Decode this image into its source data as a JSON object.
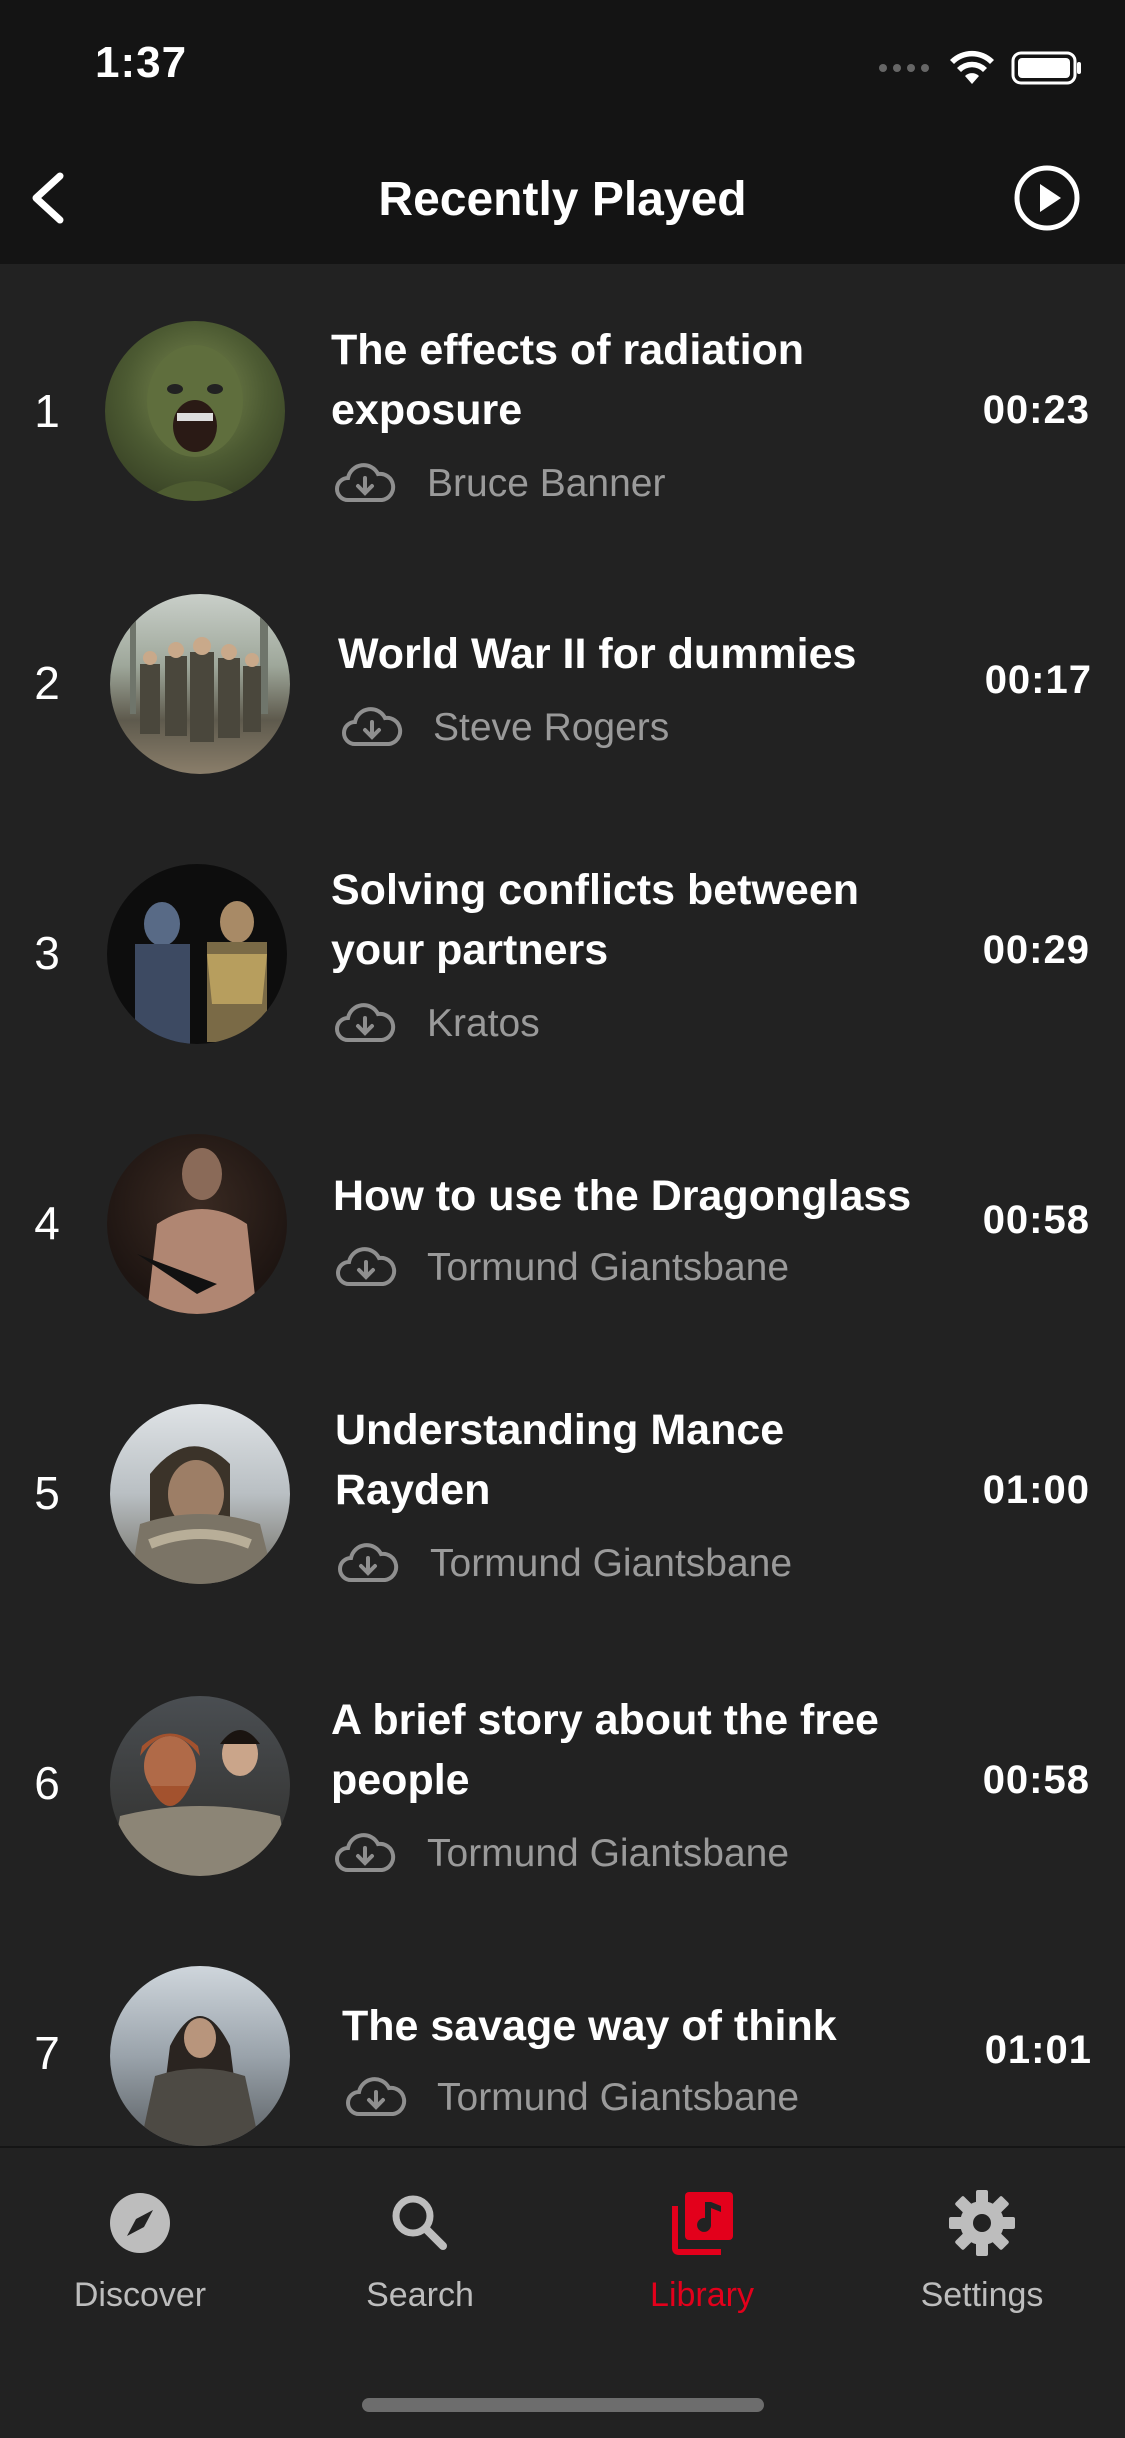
{
  "status": {
    "time": "1:37"
  },
  "header": {
    "title": "Recently Played"
  },
  "items": [
    {
      "index": "1",
      "title": "The effects of radiation exposure",
      "author": "Bruce Banner",
      "duration": "00:23"
    },
    {
      "index": "2",
      "title": "World War II for dummies",
      "author": "Steve Rogers",
      "duration": "00:17"
    },
    {
      "index": "3",
      "title": "Solving conflicts between your partners",
      "author": "Kratos",
      "duration": "00:29"
    },
    {
      "index": "4",
      "title": "How to use the Dragonglass",
      "author": "Tormund Giantsbane",
      "duration": "00:58"
    },
    {
      "index": "5",
      "title": "Understanding Mance Rayden",
      "author": "Tormund Giantsbane",
      "duration": "01:00"
    },
    {
      "index": "6",
      "title": "A brief story about the free people",
      "author": "Tormund Giantsbane",
      "duration": "00:58"
    },
    {
      "index": "7",
      "title": "The savage way of think",
      "author": "Tormund Giantsbane",
      "duration": "01:01"
    }
  ],
  "tabs": [
    {
      "label": "Discover",
      "icon": "compass-icon"
    },
    {
      "label": "Search",
      "icon": "search-icon"
    },
    {
      "label": "Library",
      "icon": "music-library-icon",
      "active": true
    },
    {
      "label": "Settings",
      "icon": "gear-icon"
    }
  ],
  "colors": {
    "accent": "#e3001b",
    "background": "#222222",
    "bar": "#141414",
    "secondary_text": "#9a9a9a"
  }
}
